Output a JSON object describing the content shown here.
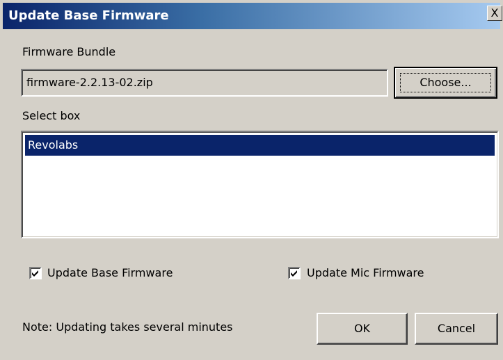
{
  "dialog": {
    "title": "Update Base Firmware",
    "close_label": "X"
  },
  "bundle": {
    "label": "Firmware Bundle",
    "value": "firmware-2.2.13-02.zip",
    "choose_label": "Choose..."
  },
  "select_box": {
    "label": "Select box",
    "items": [
      {
        "label": "Revolabs",
        "selected": true
      }
    ]
  },
  "options": {
    "update_base": {
      "label": "Update Base Firmware",
      "checked": true
    },
    "update_mic": {
      "label": "Update Mic Firmware",
      "checked": true
    }
  },
  "footer": {
    "note": "Note: Updating takes several minutes",
    "ok_label": "OK",
    "cancel_label": "Cancel"
  },
  "colors": {
    "title_gradient_start": "#0a246a",
    "title_gradient_end": "#a6caf0",
    "selection": "#0a246a",
    "face": "#d4d0c8"
  }
}
